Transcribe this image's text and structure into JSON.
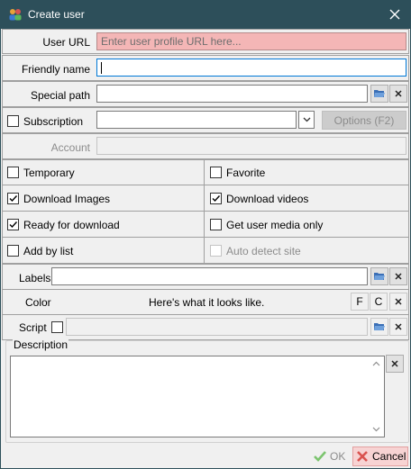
{
  "window": {
    "title": "Create user"
  },
  "fields": {
    "user_url": {
      "label": "User URL",
      "placeholder": "Enter user profile URL here..."
    },
    "friendly_name": {
      "label": "Friendly name",
      "value": ""
    },
    "special_path": {
      "label": "Special path",
      "value": ""
    },
    "subscription": {
      "label": "Subscription",
      "checked": false,
      "value": "",
      "options_button": "Options (F2)"
    },
    "account": {
      "label": "Account",
      "value": ""
    }
  },
  "checkboxes": [
    {
      "label": "Temporary",
      "checked": false
    },
    {
      "label": "Favorite",
      "checked": false
    },
    {
      "label": "Download Images",
      "checked": true
    },
    {
      "label": "Download videos",
      "checked": true
    },
    {
      "label": "Ready for download",
      "checked": true
    },
    {
      "label": "Get user media only",
      "checked": false
    },
    {
      "label": "Add by list",
      "checked": false
    },
    {
      "label": "Auto detect site",
      "checked": false,
      "disabled": true
    }
  ],
  "labels_field": {
    "label": "Labels",
    "value": ""
  },
  "color": {
    "label": "Color",
    "preview_text": "Here's what it looks like.",
    "f_button": "F",
    "c_button": "C"
  },
  "script": {
    "label": "Script",
    "checked": false,
    "value": ""
  },
  "description": {
    "label": "Description",
    "value": ""
  },
  "footer": {
    "ok": "OK",
    "cancel": "Cancel"
  },
  "colors": {
    "titlebar": "#2d4f5a",
    "url_invalid": "#f4b6b6",
    "ok_green": "#5cb85c",
    "cancel_red": "#d9534f"
  }
}
